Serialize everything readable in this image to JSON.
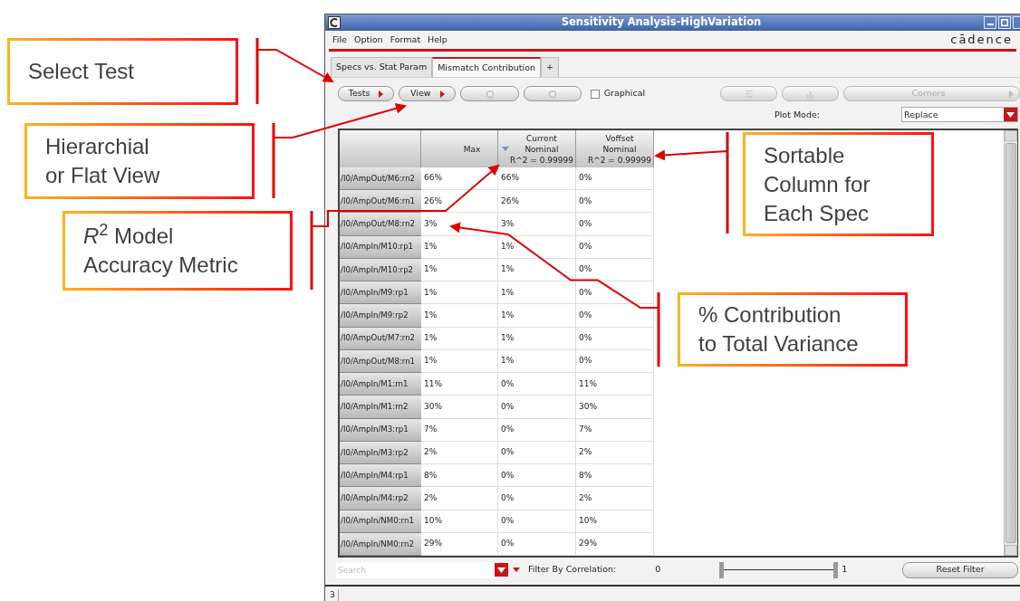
{
  "window": {
    "title": "Sensitivity Analysis-HighVariation"
  },
  "menu": [
    "File",
    "Option",
    "Format",
    "Help"
  ],
  "logo": "cādence",
  "tabs": [
    {
      "label": "Specs vs. Stat Param",
      "selected": false
    },
    {
      "label": "Mismatch Contribution",
      "selected": true
    },
    {
      "label": "+",
      "selected": false
    }
  ],
  "toolbar": {
    "left_buttons": [
      {
        "kind": "menu",
        "label": "Tests"
      },
      {
        "kind": "menu",
        "label": "View"
      },
      {
        "kind": "icon"
      },
      {
        "kind": "icon"
      }
    ],
    "graphical": {
      "label": "Graphical",
      "checked": false
    },
    "right_buttons": [
      {
        "kind": "icon",
        "disabled": true
      },
      {
        "kind": "icon",
        "disabled": true
      },
      {
        "kind": "menu",
        "label": "Corners",
        "disabled": true
      }
    ]
  },
  "plot_mode": {
    "label": "Plot Mode:",
    "value": "Replace"
  },
  "table": {
    "columns": [
      {
        "label": "Max",
        "sorted": false
      },
      {
        "label": "Current\nNominal\nR^2 = 0.99999",
        "sorted": true
      },
      {
        "label": "Voffset\nNominal\nR^2 = 0.99999",
        "sorted": false
      }
    ],
    "rows": [
      {
        "name": "/I0/AmpOut/M6:rn2",
        "values": [
          "66%",
          "66%",
          "0%"
        ]
      },
      {
        "name": "/I0/AmpOut/M6:rn1",
        "values": [
          "26%",
          "26%",
          "0%"
        ]
      },
      {
        "name": "/I0/AmpOut/M8:rn2",
        "values": [
          "3%",
          "3%",
          "0%"
        ]
      },
      {
        "name": "/I0/AmpIn/M10:rp1",
        "values": [
          "1%",
          "1%",
          "0%"
        ]
      },
      {
        "name": "/I0/AmpIn/M10:rp2",
        "values": [
          "1%",
          "1%",
          "0%"
        ]
      },
      {
        "name": "/I0/AmpIn/M9:rp1",
        "values": [
          "1%",
          "1%",
          "0%"
        ]
      },
      {
        "name": "/I0/AmpIn/M9:rp2",
        "values": [
          "1%",
          "1%",
          "0%"
        ]
      },
      {
        "name": "/I0/AmpOut/M7:rn2",
        "values": [
          "1%",
          "1%",
          "0%"
        ]
      },
      {
        "name": "/I0/AmpOut/M8:rn1",
        "values": [
          "1%",
          "1%",
          "0%"
        ]
      },
      {
        "name": "/I0/AmpIn/M1:rn1",
        "values": [
          "11%",
          "0%",
          "11%"
        ]
      },
      {
        "name": "/I0/AmpIn/M1:rn2",
        "values": [
          "30%",
          "0%",
          "30%"
        ]
      },
      {
        "name": "/I0/AmpIn/M3:rp1",
        "values": [
          "7%",
          "0%",
          "7%"
        ]
      },
      {
        "name": "/I0/AmpIn/M3:rp2",
        "values": [
          "2%",
          "0%",
          "2%"
        ]
      },
      {
        "name": "/I0/AmpIn/M4:rp1",
        "values": [
          "8%",
          "0%",
          "8%"
        ]
      },
      {
        "name": "/I0/AmpIn/M4:rp2",
        "values": [
          "2%",
          "0%",
          "2%"
        ]
      },
      {
        "name": "/I0/AmpIn/NM0:rn1",
        "values": [
          "10%",
          "0%",
          "10%"
        ]
      },
      {
        "name": "/I0/AmpIn/NM0:rn2",
        "values": [
          "29%",
          "0%",
          "29%"
        ]
      }
    ]
  },
  "filter": {
    "placeholder": "Search",
    "label": "Filter By Correlation:",
    "min_label": "0",
    "max_label": "1",
    "thumbs": [
      {
        "level": 0
      },
      {
        "level": 1
      }
    ],
    "reset": "Reset Filter"
  },
  "status_bar": {
    "text": "3"
  },
  "callouts": [
    {
      "text": "Select Test"
    },
    {
      "text": "Hierarchial\nor Flat View"
    },
    {
      "text": "*R*$^{2}$  Model\nAccuracy Metric"
    },
    {
      "text": "Sortable\nColumn for\nEach Spec"
    },
    {
      "text": "% Contribution\nto Total Variance"
    }
  ]
}
